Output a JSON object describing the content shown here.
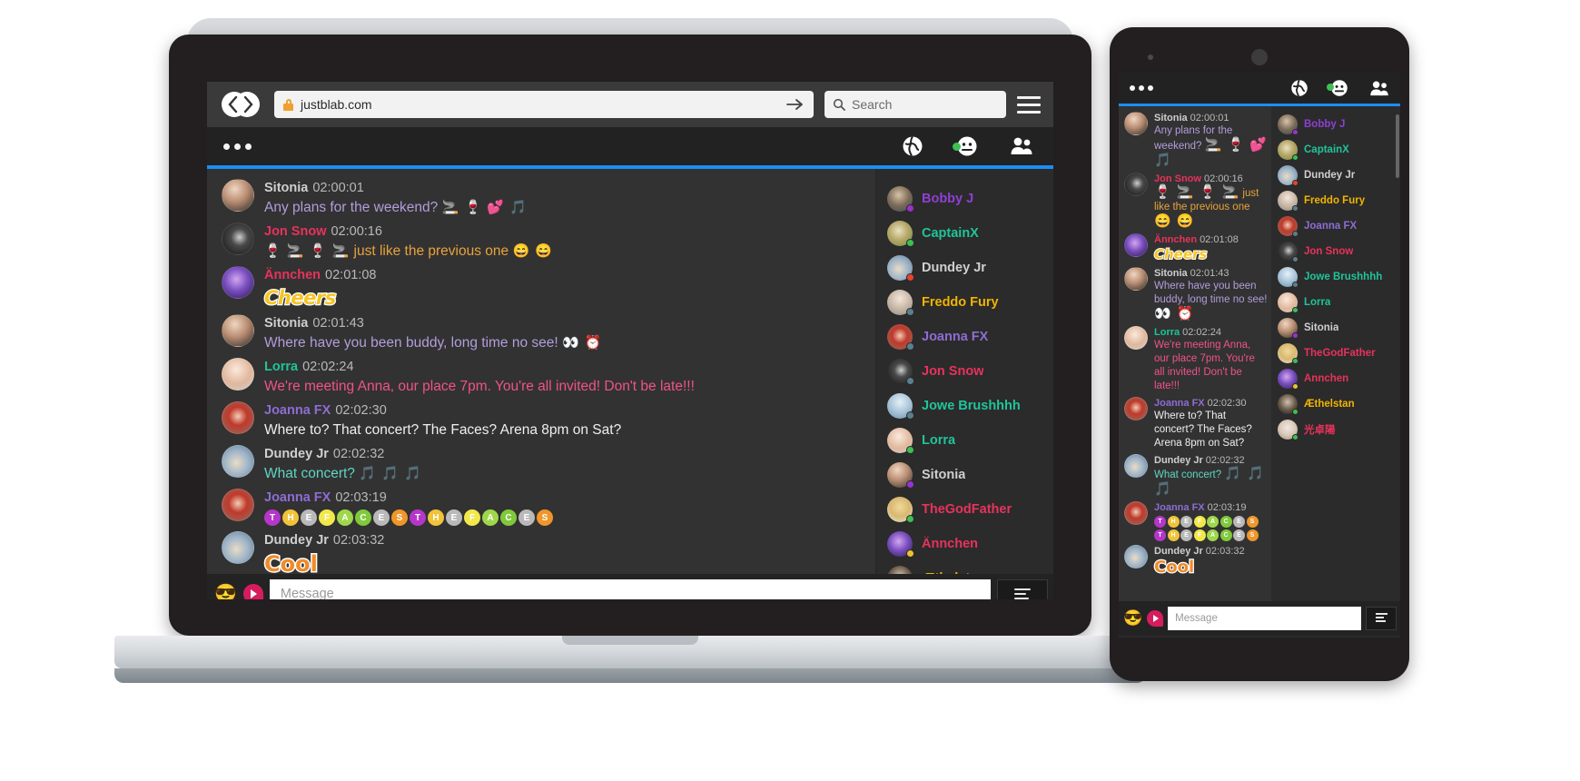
{
  "browser": {
    "url": "justblab.com",
    "search_placeholder": "Search",
    "lock_icon": "lock-icon",
    "go_icon": "arrow-right-icon",
    "back_icon": "back-arrow-icon",
    "forward_icon": "forward-arrow-icon",
    "menu_icon": "hamburger-menu-icon"
  },
  "app": {
    "menu_icon": "three-dots-icon",
    "header_icons": [
      {
        "name": "globe-icon",
        "glyph": "🌐"
      },
      {
        "name": "face-status-icon",
        "glyph": "😶",
        "badge_color": "#3fbf52"
      },
      {
        "name": "people-icon",
        "glyph": "👥"
      }
    ],
    "accent_color": "#1b8ef2",
    "input": {
      "placeholder": "Message",
      "value": "",
      "emoji_icon": "sunglasses-emoji-icon",
      "sticker_icon": "sticker-send-icon",
      "send_icon": "send-lines-icon"
    }
  },
  "messages": [
    {
      "user": "Sitonia",
      "time": "02:00:01",
      "user_color": "#cfcfcf",
      "text": "Any plans for the weekend?",
      "text_color": "#b39ddb",
      "emojis": "🚬 🍷 💕 🎵",
      "avatar": "sitonia",
      "kind": "text"
    },
    {
      "user": "Jon Snow",
      "time": "02:00:16",
      "user_color": "#e8325c",
      "text": "just like the previous one",
      "text_color": "#e8a33d",
      "emojis_before": "🍷 🚬 🍷 🚬",
      "emojis": "😄 😄",
      "avatar": "jonsnow",
      "kind": "text"
    },
    {
      "user": "Ännchen",
      "time": "02:01:08",
      "user_color": "#e8325c",
      "text": "Cheers",
      "text_color": "#f5c425",
      "avatar": "annchen",
      "kind": "sticker-cheers"
    },
    {
      "user": "Sitonia",
      "time": "02:01:43",
      "user_color": "#cfcfcf",
      "text": "Where have you been buddy, long time no see!",
      "text_color": "#b39ddb",
      "emojis": "👀 ⏰",
      "avatar": "sitonia",
      "kind": "text"
    },
    {
      "user": "Lorra",
      "time": "02:02:24",
      "user_color": "#1fc49a",
      "text": "We're meeting Anna, our place 7pm. You're all invited! Don't be late!!!",
      "text_color": "#f0528c",
      "avatar": "lorra",
      "kind": "text"
    },
    {
      "user": "Joanna FX",
      "time": "02:02:30",
      "user_color": "#8e6cd4",
      "text": "Where to? That concert? The Faces? Arena 8pm on Sat?",
      "text_color": "#efefef",
      "avatar": "joanna",
      "kind": "text"
    },
    {
      "user": "Dundey Jr",
      "time": "02:02:32",
      "user_color": "#cfcfcf",
      "text": "What concert?",
      "text_color": "#5fd6c4",
      "emojis": "🎵 🎵 🎵",
      "avatar": "dundey",
      "kind": "text"
    },
    {
      "user": "Joanna FX",
      "time": "02:03:19",
      "user_color": "#8e6cd4",
      "avatar": "joanna",
      "kind": "faces",
      "faces": [
        {
          "ch": "T",
          "bg": "#b536c9"
        },
        {
          "ch": "H",
          "bg": "#f0c33a"
        },
        {
          "ch": "E",
          "bg": "#b9b9b9"
        },
        {
          "ch": "F",
          "bg": "#f2e84a"
        },
        {
          "ch": "A",
          "bg": "#9ed84a"
        },
        {
          "ch": "C",
          "bg": "#7fc93a"
        },
        {
          "ch": "E",
          "bg": "#b9b9b9"
        },
        {
          "ch": "S",
          "bg": "#f0962a"
        },
        {
          "ch": "T",
          "bg": "#b536c9"
        },
        {
          "ch": "H",
          "bg": "#f0c33a"
        },
        {
          "ch": "E",
          "bg": "#b9b9b9"
        },
        {
          "ch": "F",
          "bg": "#f2e84a"
        },
        {
          "ch": "A",
          "bg": "#9ed84a"
        },
        {
          "ch": "C",
          "bg": "#7fc93a"
        },
        {
          "ch": "E",
          "bg": "#b9b9b9"
        },
        {
          "ch": "S",
          "bg": "#f0962a"
        }
      ]
    },
    {
      "user": "Dundey Jr",
      "time": "02:03:32",
      "user_color": "#cfcfcf",
      "text": "Cool",
      "text_color": "#f08b2a",
      "avatar": "dundey",
      "kind": "sticker-cool"
    }
  ],
  "users": [
    {
      "name": "Bobby J",
      "color": "#8e3fd4",
      "status": "#9b30d0",
      "avatar": "bobby"
    },
    {
      "name": "CaptainX",
      "color": "#1fc49a",
      "status": "#3fbf52",
      "avatar": "captain"
    },
    {
      "name": "Dundey Jr",
      "color": "#cfcfcf",
      "status": "#e8432e",
      "avatar": "dundey"
    },
    {
      "name": "Freddo Fury",
      "color": "#f0b400",
      "status": "#5b7f8c",
      "avatar": "freddo"
    },
    {
      "name": "Joanna FX",
      "color": "#8e6cd4",
      "status": "#5b7f8c",
      "avatar": "joanna"
    },
    {
      "name": "Jon Snow",
      "color": "#e8325c",
      "status": "#5b7f8c",
      "avatar": "jonsnow"
    },
    {
      "name": "Jowe Brushhhh",
      "color": "#1fc49a",
      "status": "#5b7f8c",
      "avatar": "jowe"
    },
    {
      "name": "Lorra",
      "color": "#1fc49a",
      "status": "#3fbf52",
      "avatar": "lorra"
    },
    {
      "name": "Sitonia",
      "color": "#cfcfcf",
      "status": "#9b30d0",
      "avatar": "sitonia"
    },
    {
      "name": "TheGodFather",
      "color": "#e8325c",
      "status": "#3fbf52",
      "avatar": "godfather"
    },
    {
      "name": "Ännchen",
      "color": "#e8325c",
      "status": "#e8c52e",
      "avatar": "annchen"
    },
    {
      "name": "Æthelstan",
      "color": "#f0b400",
      "status": "#3fbf52",
      "avatar": "aethelstan"
    },
    {
      "name": "光卓陽",
      "color": "#e8325c",
      "status": "#3fbf52",
      "avatar": "guang"
    }
  ]
}
